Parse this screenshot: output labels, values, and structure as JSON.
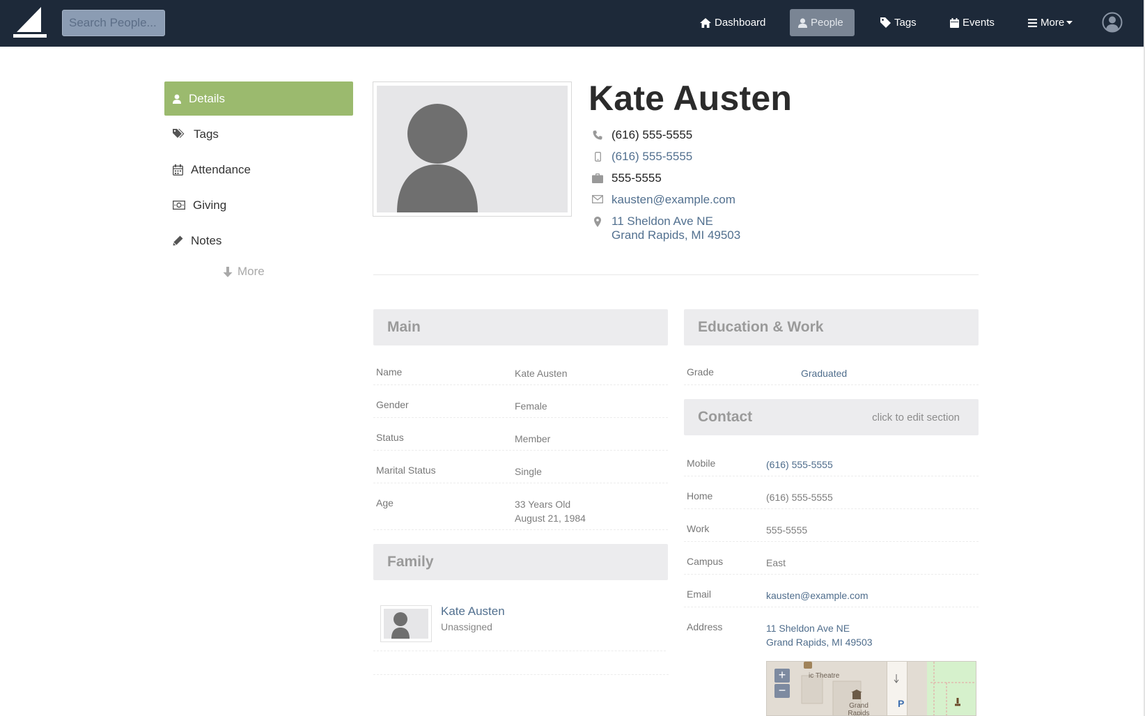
{
  "topbar": {
    "search_placeholder": "Search People...",
    "nav": [
      {
        "label": "Dashboard",
        "icon": "home-icon"
      },
      {
        "label": "People",
        "icon": "user-icon",
        "active": true
      },
      {
        "label": "Tags",
        "icon": "tag-icon"
      },
      {
        "label": "Events",
        "icon": "calendar-icon"
      },
      {
        "label": "More",
        "icon": "menu-icon"
      }
    ]
  },
  "sidebar": {
    "items": [
      {
        "label": "Details",
        "icon": "user-icon",
        "active": true
      },
      {
        "label": "Tags",
        "icon": "tags-icon"
      },
      {
        "label": "Attendance",
        "icon": "calendar-icon"
      },
      {
        "label": "Giving",
        "icon": "money-icon"
      },
      {
        "label": "Notes",
        "icon": "pencil-icon"
      }
    ],
    "more_label": "More"
  },
  "profile": {
    "name": "Kate Austen",
    "phone": "(616) 555-5555",
    "mobile": "(616) 555-5555",
    "work": "555-5555",
    "email": "kausten@example.com",
    "address_line1": "11 Sheldon Ave NE",
    "address_line2": "Grand Rapids, MI 49503"
  },
  "main": {
    "title": "Main",
    "rows": [
      {
        "label": "Name",
        "value": "Kate Austen"
      },
      {
        "label": "Gender",
        "value": "Female"
      },
      {
        "label": "Status",
        "value": "Member"
      },
      {
        "label": "Marital Status",
        "value": "Single"
      },
      {
        "label": "Age",
        "value": "33 Years Old",
        "value2": "August 21, 1984"
      }
    ]
  },
  "family": {
    "title": "Family",
    "members": [
      {
        "name": "Kate Austen",
        "role": "Unassigned"
      }
    ]
  },
  "education": {
    "title": "Education & Work",
    "rows": [
      {
        "label": "Grade",
        "value": "Graduated"
      }
    ]
  },
  "contact": {
    "title": "Contact",
    "edit_hint": "click to edit section",
    "rows": [
      {
        "label": "Mobile",
        "value": "(616) 555-5555"
      },
      {
        "label": "Home",
        "value": "(616) 555-5555"
      },
      {
        "label": "Work",
        "value": "555-5555"
      },
      {
        "label": "Campus",
        "value": "East"
      },
      {
        "label": "Email",
        "value": "kausten@example.com"
      },
      {
        "label": "Address",
        "value": "11 Sheldon Ave NE",
        "value2": "Grand Rapids, MI 49503"
      }
    ]
  },
  "map": {
    "label_theatre": "ic Theatre",
    "label_place": "Grand Rapids",
    "label_parking": "P",
    "zoom_in": "+",
    "zoom_out": "−"
  },
  "colors": {
    "topbar": "#1d2939",
    "sidebar_active": "#9bba6e",
    "link": "#52708f",
    "panel_head": "#ececee"
  }
}
